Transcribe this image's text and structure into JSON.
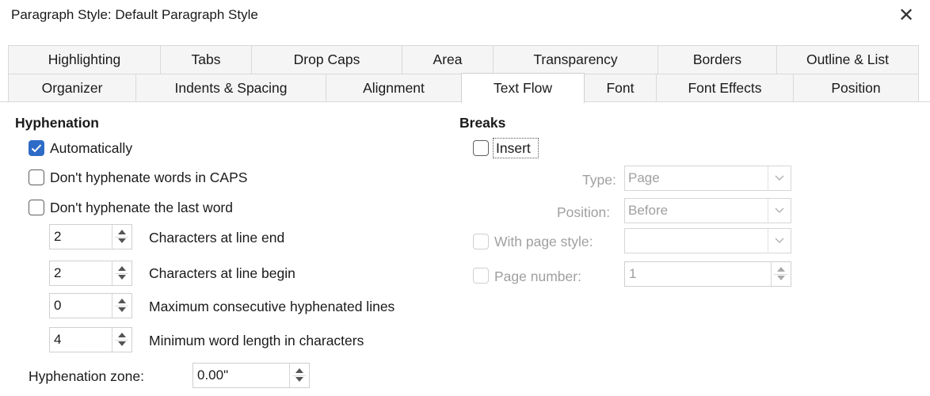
{
  "window": {
    "title": "Paragraph Style: Default Paragraph Style",
    "close_glyph": "✕"
  },
  "tabs": {
    "back_row": [
      "Highlighting",
      "Tabs",
      "Drop Caps",
      "Area",
      "Transparency",
      "Borders",
      "Outline & List"
    ],
    "front_row": [
      "Organizer",
      "Indents & Spacing",
      "Alignment",
      "Text Flow",
      "Font",
      "Font Effects",
      "Position"
    ],
    "active": "Text Flow"
  },
  "hyphenation": {
    "heading": "Hyphenation",
    "automatically": {
      "label": "Automatically",
      "checked": true
    },
    "caps": {
      "label": "Don't hyphenate words in CAPS",
      "checked": false
    },
    "last_word": {
      "label": "Don't hyphenate the last word",
      "checked": false
    },
    "chars_line_end": {
      "value": "2",
      "label": "Characters at line end"
    },
    "chars_line_begin": {
      "value": "2",
      "label": "Characters at line begin"
    },
    "max_consecutive": {
      "value": "0",
      "label": "Maximum consecutive hyphenated lines"
    },
    "min_word_length": {
      "value": "4",
      "label": "Minimum word length in characters"
    },
    "zone": {
      "label": "Hyphenation zone:",
      "value": "0.00\""
    }
  },
  "breaks": {
    "heading": "Breaks",
    "insert": {
      "label": "Insert",
      "checked": false
    },
    "type": {
      "label": "Type:",
      "value": "Page"
    },
    "position": {
      "label": "Position:",
      "value": "Before"
    },
    "with_page_style": {
      "label": "With page style:",
      "value": "",
      "checked": false
    },
    "page_number": {
      "label": "Page number:",
      "value": "1",
      "checked": false
    }
  },
  "colors": {
    "accent": "#2e6bc6",
    "disabled_text": "#a0a0a0"
  }
}
